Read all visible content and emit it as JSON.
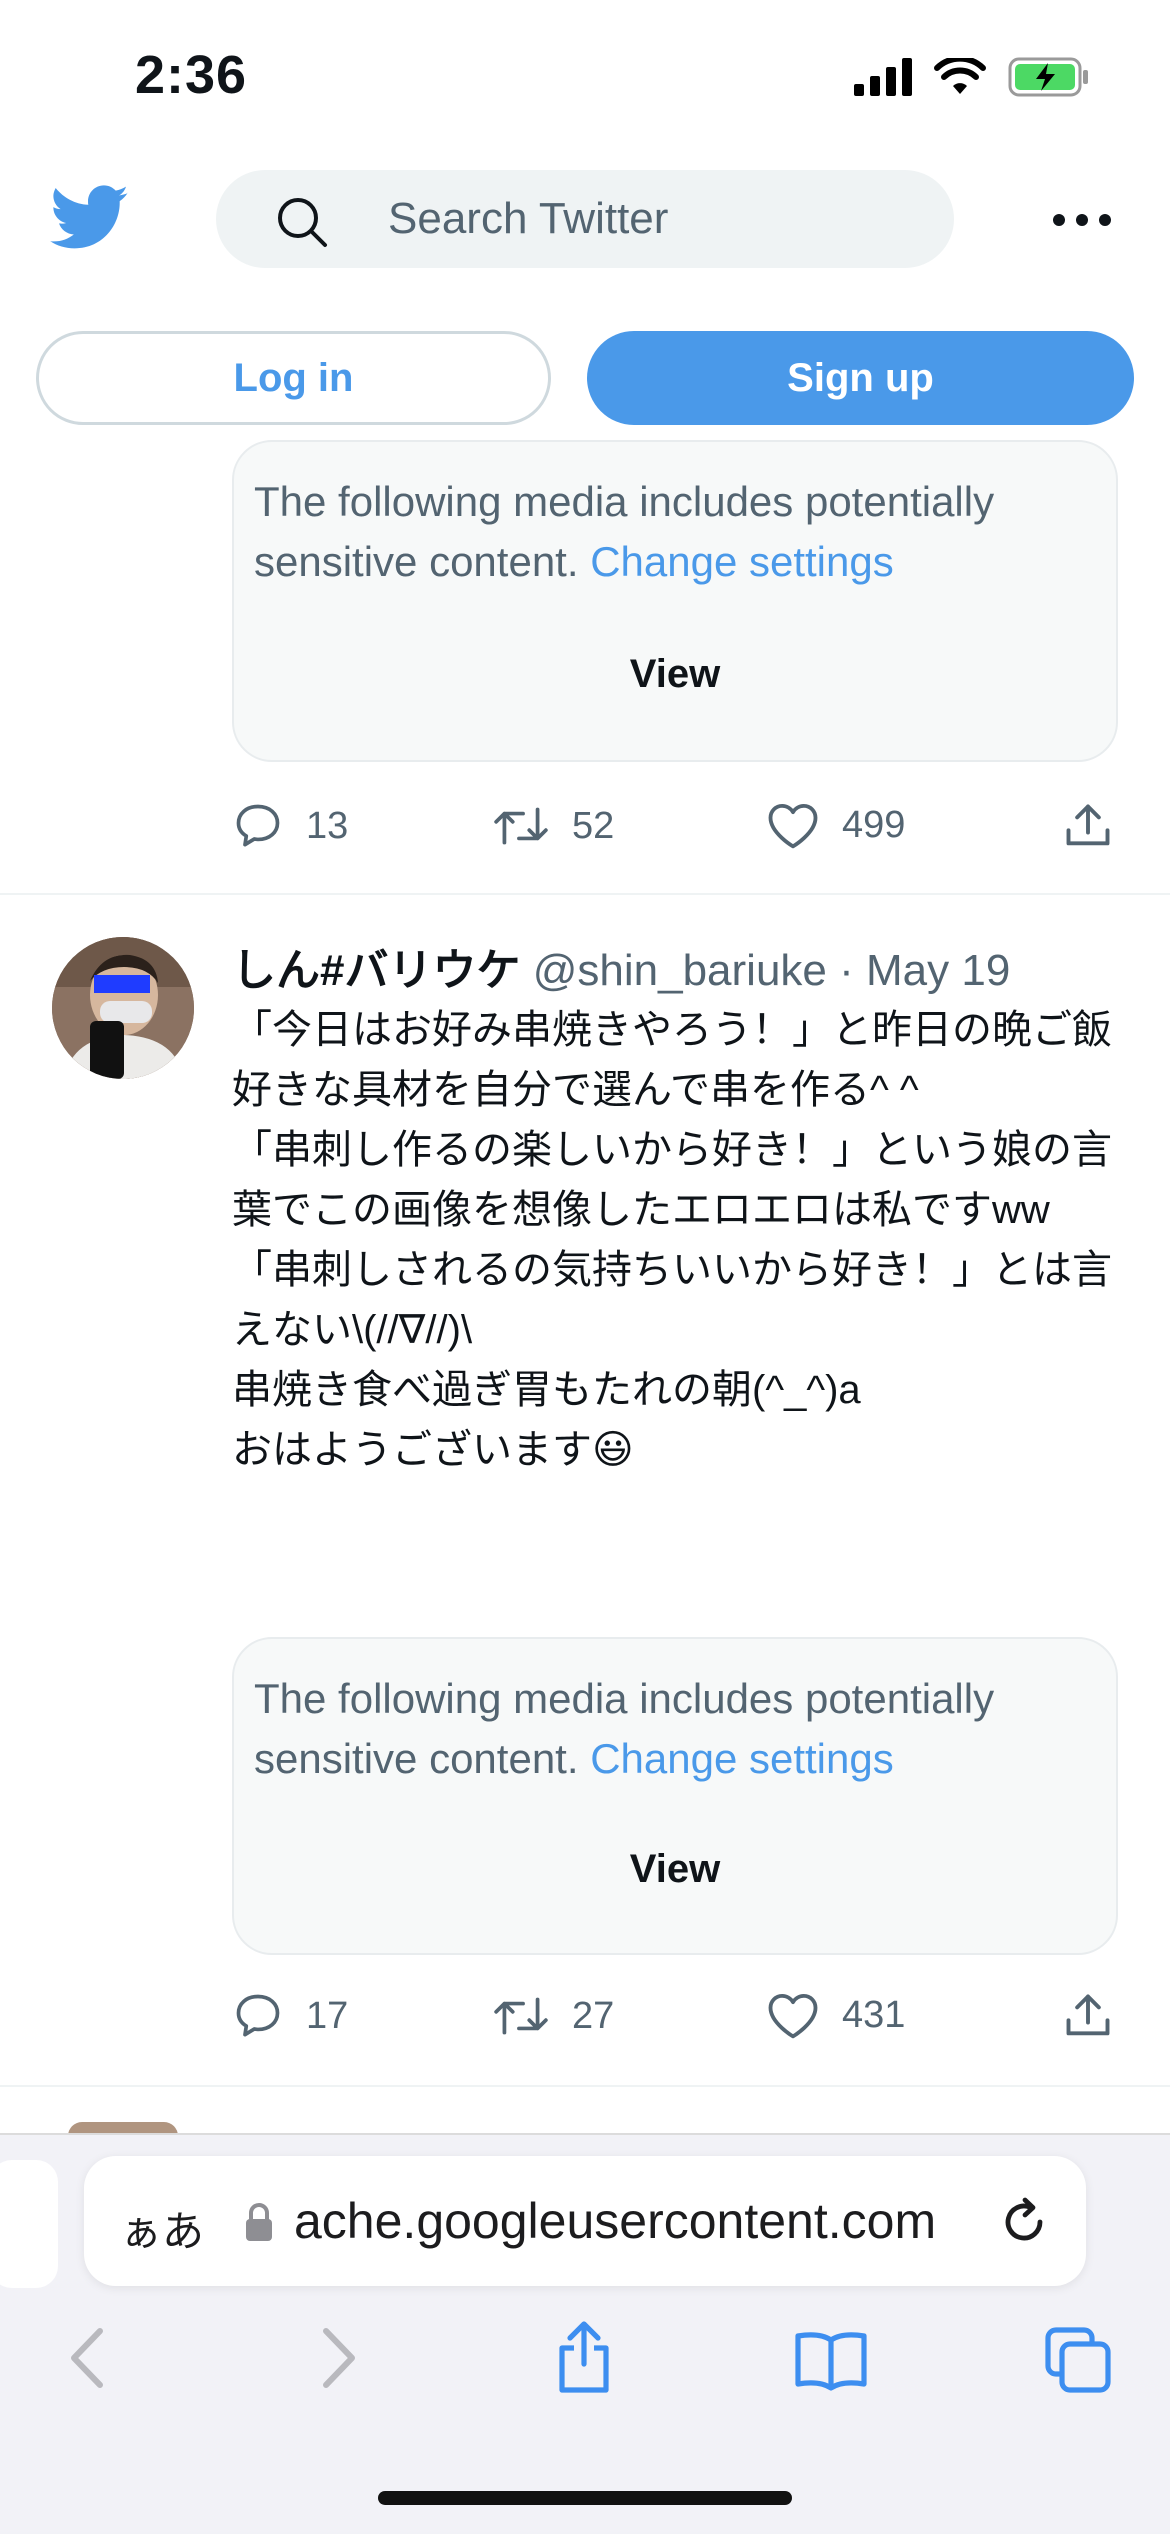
{
  "status_bar": {
    "time": "2:36"
  },
  "header": {
    "search_placeholder": "Search Twitter",
    "login_label": "Log in",
    "signup_label": "Sign up"
  },
  "tweets": [
    {
      "media_notice": "The following media includes potentially sensitive content.",
      "media_link": "Change settings",
      "view_label": "View",
      "replies": "13",
      "retweets": "52",
      "likes": "499"
    },
    {
      "name": "しん#バリウケ",
      "handle": "@shin_bariuke",
      "date": "· May 19",
      "text": "「今日はお好み串焼きやろう！」と昨日の晩ご飯\n好きな具材を自分で選んで串を作る^ ^\n「串刺し作るの楽しいから好き！」という娘の言葉でこの画像を想像したエロエロは私ですww\n「串刺しされるの気持ちいいから好き！」とは言えない\\(//∇//)\\\n串焼き食べ過ぎ胃もたれの朝(^_^)a\nおはようございます😃",
      "media_notice": "The following media includes potentially sensitive content.",
      "media_link": "Change settings",
      "view_label": "View",
      "replies": "17",
      "retweets": "27",
      "likes": "431"
    }
  ],
  "safari": {
    "aa_label": "ぁあ",
    "url": "ache.googleusercontent.com"
  },
  "colors": {
    "twitter_blue": "#4a99e9",
    "text_secondary": "#536471",
    "ios_blue": "#3d8ef0"
  }
}
